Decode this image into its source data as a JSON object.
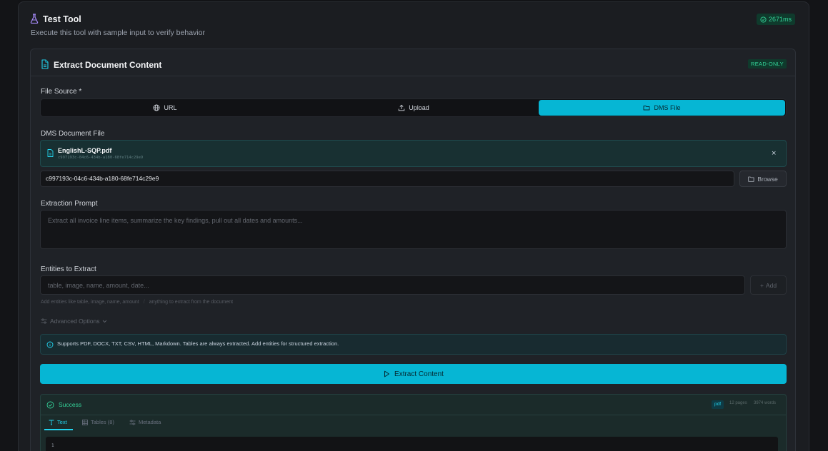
{
  "header": {
    "title": "Test Tool",
    "subtitle": "Execute this tool with sample input to verify behavior",
    "timing": "2671ms"
  },
  "card": {
    "title": "Extract Document Content",
    "badge": "READ-ONLY"
  },
  "file_source": {
    "label": "File Source *",
    "options": [
      {
        "label": "URL",
        "icon": "globe-icon"
      },
      {
        "label": "Upload",
        "icon": "upload-icon"
      },
      {
        "label": "DMS File",
        "icon": "folder-icon"
      }
    ],
    "selected": "DMS File"
  },
  "dms": {
    "label": "DMS Document File",
    "file_name": "EnglishL-SQP.pdf",
    "file_id": "c997193c-04c6-434b-a180-68fe714c29e9",
    "input_value": "c997193c-04c6-434b-a180-68fe714c29e9",
    "browse_label": "Browse"
  },
  "prompt": {
    "label": "Extraction Prompt",
    "placeholder": "Extract all invoice line items, summarize the key findings, pull out all dates and amounts..."
  },
  "entities": {
    "label": "Entities to Extract",
    "placeholder": "table, image, name, amount, date...",
    "add_label": "Add",
    "hint_left": "Add entities like table, image, name, amount",
    "hint_sep": "/",
    "hint_right": "anything to extract from the document"
  },
  "advanced": {
    "label": "Advanced Options"
  },
  "info": {
    "text": "Supports PDF, DOCX, TXT, CSV, HTML, Markdown. Tables are always extracted. Add entities for structured extraction."
  },
  "action": {
    "label": "Extract Content"
  },
  "result": {
    "status": "Success",
    "format": "pdf",
    "pages": "12 pages",
    "words": "3974 words",
    "tabs": [
      {
        "label": "Text",
        "icon": "text-icon"
      },
      {
        "label": "Tables (8)",
        "icon": "table-icon"
      },
      {
        "label": "Metadata",
        "icon": "sliders-icon"
      }
    ],
    "active_tab": "Text",
    "first_line_number": "1"
  },
  "colors": {
    "accent": "#06b6d4",
    "success": "#34d399",
    "background": "#1b1d21"
  }
}
